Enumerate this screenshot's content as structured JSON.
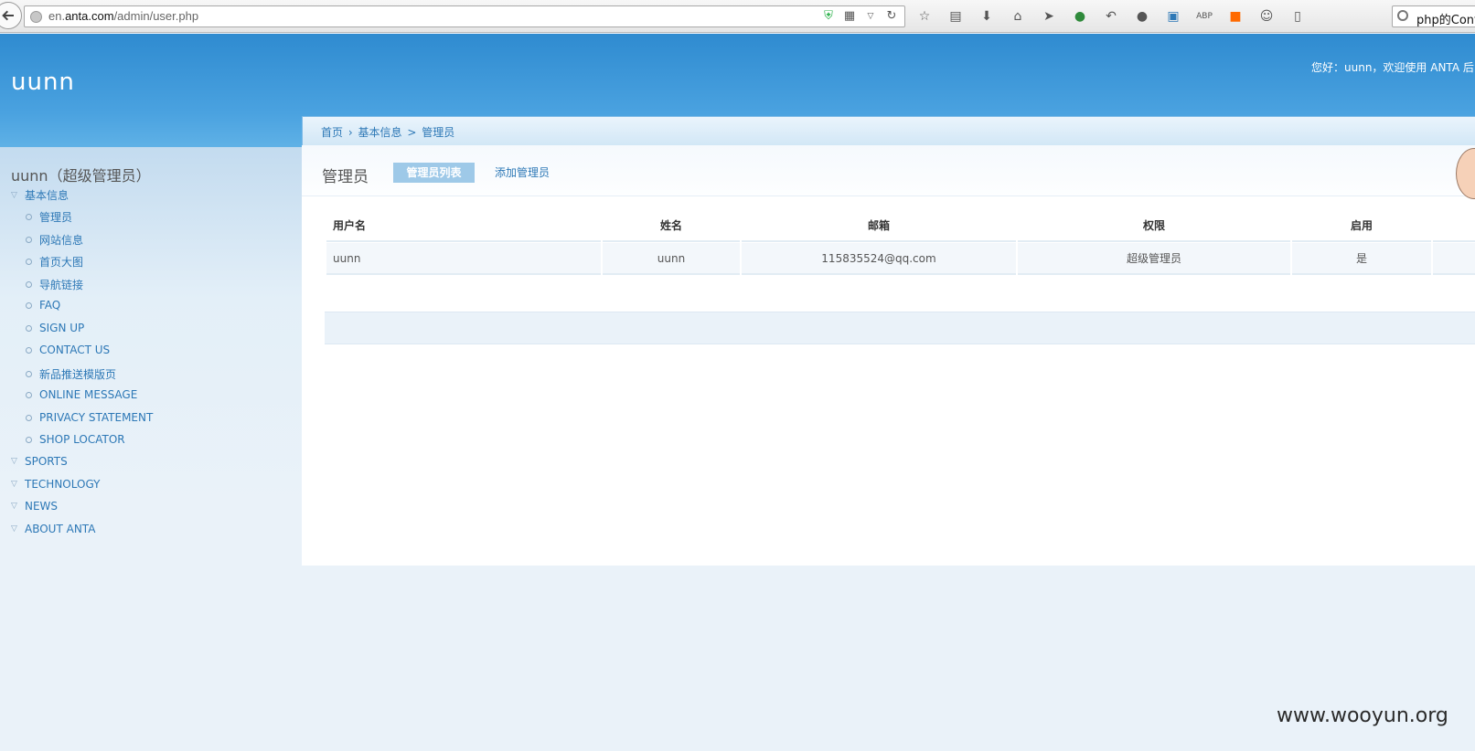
{
  "browser": {
    "url_prefix": "en.",
    "url_domain": "anta.com",
    "url_path": "/admin/user.php",
    "search_text": "php的Conte"
  },
  "header": {
    "logo": "uunn",
    "welcome": "您好：uunn，欢迎使用 ANTA 后台"
  },
  "breadcrumb": {
    "home": "首页",
    "sep1": "›",
    "section": "基本信息",
    "sep2": ">",
    "current": "管理员"
  },
  "sidebar": {
    "user_heading": "uunn（超级管理员）",
    "groups": [
      {
        "label": "基本信息"
      },
      {
        "label": "SPORTS"
      },
      {
        "label": "TECHNOLOGY"
      },
      {
        "label": "NEWS"
      },
      {
        "label": "ABOUT ANTA"
      }
    ],
    "sub_items": [
      {
        "label": "管理员"
      },
      {
        "label": "网站信息"
      },
      {
        "label": "首页大图"
      },
      {
        "label": "导航链接"
      },
      {
        "label": "FAQ"
      },
      {
        "label": "SIGN UP"
      },
      {
        "label": "CONTACT US"
      },
      {
        "label": "新品推送模版页"
      },
      {
        "label": "ONLINE MESSAGE"
      },
      {
        "label": "PRIVACY STATEMENT"
      },
      {
        "label": "SHOP LOCATOR"
      }
    ]
  },
  "main": {
    "title": "管理员",
    "tab_active": "管理员列表",
    "tab_add": "添加管理员",
    "table": {
      "headers": [
        "用户名",
        "姓名",
        "邮箱",
        "权限",
        "启用"
      ],
      "rows": [
        [
          "uunn",
          "uunn",
          "115835524@qq.com",
          "超级管理员",
          "是"
        ]
      ]
    }
  },
  "watermark": "www.wooyun.org"
}
